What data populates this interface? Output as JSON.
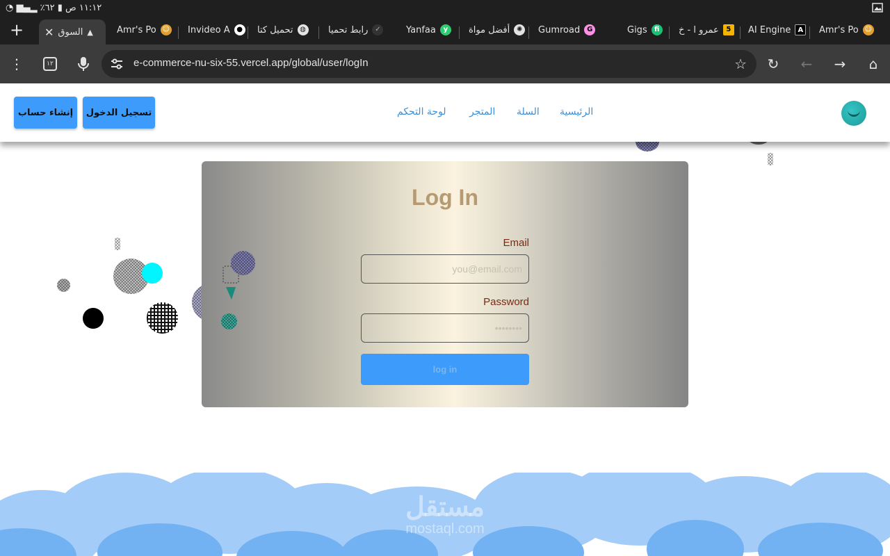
{
  "statusbar": {
    "time": "١١:١٢ ص",
    "battery": "٦٢٪"
  },
  "tabs": [
    {
      "label": "السوق",
      "active": true,
      "icon": "triangle-icon"
    },
    {
      "label": "Amr's Po",
      "icon": "avatar-icon"
    },
    {
      "label": "Invideo A",
      "icon": "invideo-icon"
    },
    {
      "label": "تحميل كتا",
      "icon": "globe-icon"
    },
    {
      "label": "رابط تحميا",
      "icon": "shield-icon"
    },
    {
      "label": "Yanfaa",
      "icon": "yanfaa-icon"
    },
    {
      "label": "أفضل مواة",
      "icon": "openai-icon"
    },
    {
      "label": "Gumroad",
      "icon": "gumroad-icon"
    },
    {
      "label": "Gigs",
      "icon": "fiverr-icon"
    },
    {
      "label": "عمرو ا - خ",
      "icon": "number5-icon"
    },
    {
      "label": "AI Engine",
      "icon": "aiengine-icon"
    },
    {
      "label": "Amr's Po",
      "icon": "avatar-icon"
    }
  ],
  "toolbar": {
    "url": "e-commerce-nu-six-55.vercel.app/global/user/logIn",
    "tab_count": "١٢"
  },
  "nav": {
    "signup": "إنشاء حساب",
    "login": "تسجيل الدخول",
    "links": [
      "لوحة التحكم",
      "المتجر",
      "السلة",
      "الرئيسية"
    ]
  },
  "login": {
    "title": "Log In",
    "email_label": "Email",
    "email_placeholder": "you@email.com",
    "password_label": "Password",
    "password_placeholder": "••••••••",
    "submit": "log in"
  },
  "watermark": {
    "ar": "مستقل",
    "en": "mostaql.com"
  },
  "colors": {
    "accent": "#3d9bfb",
    "label": "#7a2a12",
    "cloud_light": "#9ec9f7",
    "cloud_dark": "#6aaef0"
  }
}
